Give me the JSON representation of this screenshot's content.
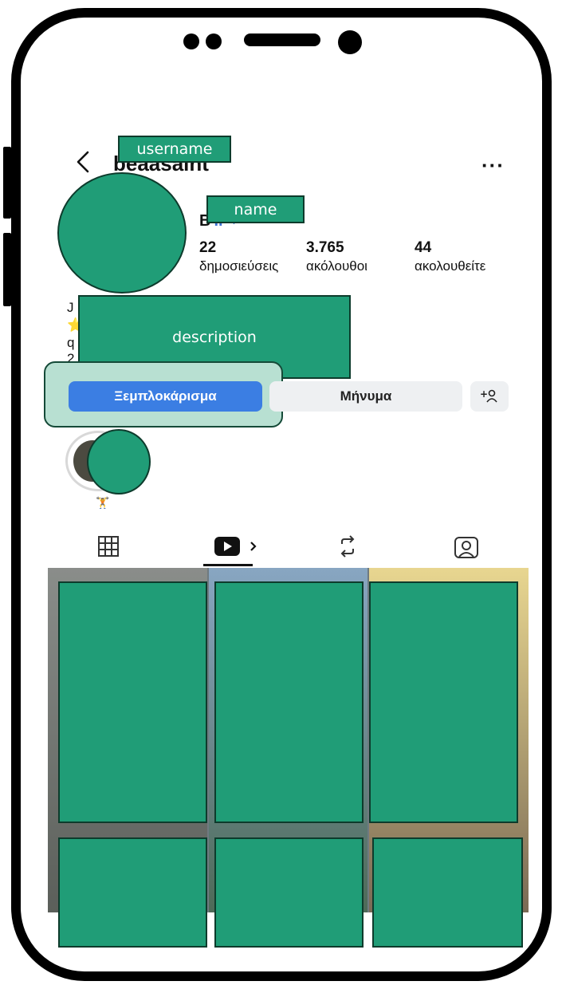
{
  "profile": {
    "username_label": "username",
    "username_visible": "beaasaint",
    "name_label": "name",
    "name_visible": "B",
    "description_label": "description",
    "description_lines": [
      "J",
      "⭐",
      "q",
      "2"
    ]
  },
  "header": {
    "back_icon": "chevron-left-icon",
    "more_label": "···"
  },
  "stats": [
    {
      "value": "22",
      "label": "δημοσιεύσεις"
    },
    {
      "value": "3.765",
      "label": "ακόλουθοι"
    },
    {
      "value": "44",
      "label": "ακολουθείτε"
    }
  ],
  "actions": {
    "unblock": "Ξεμπλοκάρισμα",
    "message": "Μήνυμα",
    "add_user": "+ꝏ"
  },
  "tabs": [
    {
      "icon": "grid-icon"
    },
    {
      "icon": "reels-icon",
      "suffix": ">"
    },
    {
      "icon": "repost-icon"
    },
    {
      "icon": "tagged-icon"
    }
  ],
  "colors": {
    "redaction": "#209d77",
    "highlight": "#b8e0d2",
    "primary_button": "#3b7ee3"
  }
}
